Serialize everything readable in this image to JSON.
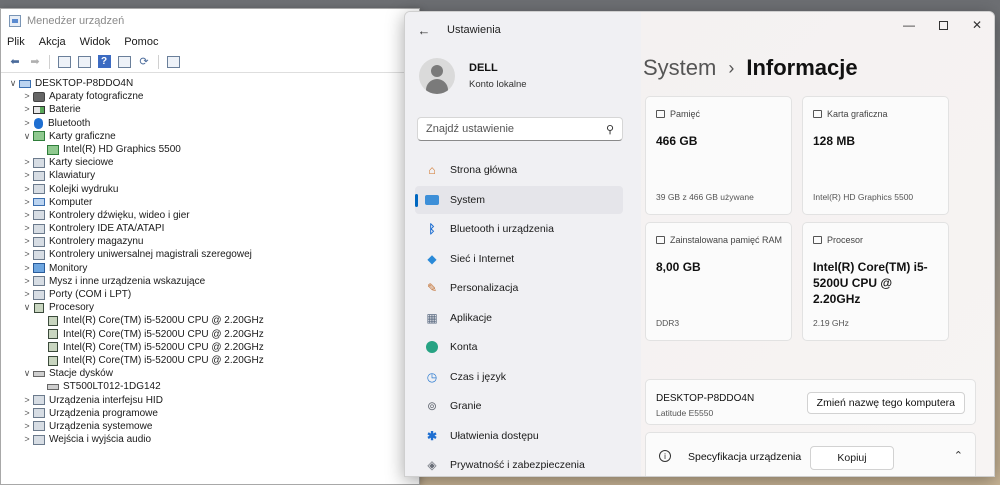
{
  "device_manager": {
    "title": "Menedżer urządzeń",
    "menu": [
      "Plik",
      "Akcja",
      "Widok",
      "Pomoc"
    ],
    "toolbar": [
      "back-icon",
      "forward-icon",
      "properties-icon",
      "tree-icon",
      "help-icon",
      "details-icon",
      "refresh-icon",
      "monitor-icon"
    ],
    "tree": [
      {
        "label": "DESKTOP-P8DDO4N",
        "level": 0,
        "chevron": "∨",
        "icon": "computer"
      },
      {
        "label": "Aparaty fotograficzne",
        "level": 1,
        "chevron": ">",
        "icon": "camera"
      },
      {
        "label": "Baterie",
        "level": 1,
        "chevron": ">",
        "icon": "battery"
      },
      {
        "label": "Bluetooth",
        "level": 1,
        "chevron": ">",
        "icon": "bluetooth"
      },
      {
        "label": "Karty graficzne",
        "level": 1,
        "chevron": "∨",
        "icon": "gpu"
      },
      {
        "label": "Intel(R) HD Graphics 5500",
        "level": 2,
        "chevron": "",
        "icon": "gpu"
      },
      {
        "label": "Karty sieciowe",
        "level": 1,
        "chevron": ">",
        "icon": "generic"
      },
      {
        "label": "Klawiatury",
        "level": 1,
        "chevron": ">",
        "icon": "generic"
      },
      {
        "label": "Kolejki wydruku",
        "level": 1,
        "chevron": ">",
        "icon": "generic"
      },
      {
        "label": "Komputer",
        "level": 1,
        "chevron": ">",
        "icon": "computer"
      },
      {
        "label": "Kontrolery dźwięku, wideo i gier",
        "level": 1,
        "chevron": ">",
        "icon": "generic"
      },
      {
        "label": "Kontrolery IDE ATA/ATAPI",
        "level": 1,
        "chevron": ">",
        "icon": "generic"
      },
      {
        "label": "Kontrolery magazynu",
        "level": 1,
        "chevron": ">",
        "icon": "generic"
      },
      {
        "label": "Kontrolery uniwersalnej magistrali szeregowej",
        "level": 1,
        "chevron": ">",
        "icon": "generic"
      },
      {
        "label": "Monitory",
        "level": 1,
        "chevron": ">",
        "icon": "monitor"
      },
      {
        "label": "Mysz i inne urządzenia wskazujące",
        "level": 1,
        "chevron": ">",
        "icon": "generic"
      },
      {
        "label": "Porty (COM i LPT)",
        "level": 1,
        "chevron": ">",
        "icon": "generic"
      },
      {
        "label": "Procesory",
        "level": 1,
        "chevron": "∨",
        "icon": "cpu"
      },
      {
        "label": "Intel(R) Core(TM) i5-5200U CPU @ 2.20GHz",
        "level": 2,
        "chevron": "",
        "icon": "cpu"
      },
      {
        "label": "Intel(R) Core(TM) i5-5200U CPU @ 2.20GHz",
        "level": 2,
        "chevron": "",
        "icon": "cpu"
      },
      {
        "label": "Intel(R) Core(TM) i5-5200U CPU @ 2.20GHz",
        "level": 2,
        "chevron": "",
        "icon": "cpu"
      },
      {
        "label": "Intel(R) Core(TM) i5-5200U CPU @ 2.20GHz",
        "level": 2,
        "chevron": "",
        "icon": "cpu"
      },
      {
        "label": "Stacje dysków",
        "level": 1,
        "chevron": "∨",
        "icon": "disk"
      },
      {
        "label": "ST500LT012-1DG142",
        "level": 2,
        "chevron": "",
        "icon": "disk"
      },
      {
        "label": "Urządzenia interfejsu HID",
        "level": 1,
        "chevron": ">",
        "icon": "generic"
      },
      {
        "label": "Urządzenia programowe",
        "level": 1,
        "chevron": ">",
        "icon": "generic"
      },
      {
        "label": "Urządzenia systemowe",
        "level": 1,
        "chevron": ">",
        "icon": "generic"
      },
      {
        "label": "Wejścia i wyjścia audio",
        "level": 1,
        "chevron": ">",
        "icon": "generic"
      }
    ]
  },
  "settings": {
    "app_title": "Ustawienia",
    "user": {
      "name": "DELL",
      "account": "Konto lokalne"
    },
    "search_placeholder": "Znajdź ustawienie",
    "nav": [
      {
        "label": "Strona główna",
        "icon": "home-icon",
        "glyph": "⌂",
        "cls": "ni-home"
      },
      {
        "label": "System",
        "icon": "system-icon",
        "glyph": "",
        "cls": "ni-sys",
        "active": true
      },
      {
        "label": "Bluetooth i urządzenia",
        "icon": "bluetooth-icon",
        "glyph": "ᛒ",
        "cls": "ni-bt"
      },
      {
        "label": "Sieć i Internet",
        "icon": "wifi-icon",
        "glyph": "◆",
        "cls": "ni-net"
      },
      {
        "label": "Personalizacja",
        "icon": "brush-icon",
        "glyph": "✎",
        "cls": "ni-pers"
      },
      {
        "label": "Aplikacje",
        "icon": "apps-icon",
        "glyph": "▦",
        "cls": "ni-apps"
      },
      {
        "label": "Konta",
        "icon": "account-icon",
        "glyph": "",
        "cls": "ni-acc"
      },
      {
        "label": "Czas i język",
        "icon": "globe-clock-icon",
        "glyph": "◷",
        "cls": "ni-time"
      },
      {
        "label": "Granie",
        "icon": "gamepad-icon",
        "glyph": "⊚",
        "cls": "ni-game"
      },
      {
        "label": "Ułatwienia dostępu",
        "icon": "accessibility-icon",
        "glyph": "✱",
        "cls": "ni-a11y"
      },
      {
        "label": "Prywatność i zabezpieczenia",
        "icon": "shield-icon",
        "glyph": "◈",
        "cls": "ni-priv"
      }
    ],
    "breadcrumb": {
      "parent": "System",
      "separator": "›",
      "current": "Informacje"
    },
    "cards": {
      "storage": {
        "label": "Pamięć",
        "value": "466 GB",
        "sub": "39 GB z 466 GB używane"
      },
      "gpu": {
        "label": "Karta graficzna",
        "value": "128 MB",
        "sub": "Intel(R) HD Graphics 5500"
      },
      "ram": {
        "label": "Zainstalowana pamięć RAM",
        "value": "8,00 GB",
        "sub": "DDR3"
      },
      "cpu": {
        "label": "Procesor",
        "value": "Intel(R) Core(TM) i5-5200U CPU @ 2.20GHz",
        "sub": "2.19 GHz"
      }
    },
    "device": {
      "name": "DESKTOP-P8DDO4N",
      "model": "Latitude E5550",
      "rename_label": "Zmień nazwę tego komputera"
    },
    "spec": {
      "title": "Specyfikacja urządzenia",
      "copy_label": "Kopiuj"
    }
  }
}
